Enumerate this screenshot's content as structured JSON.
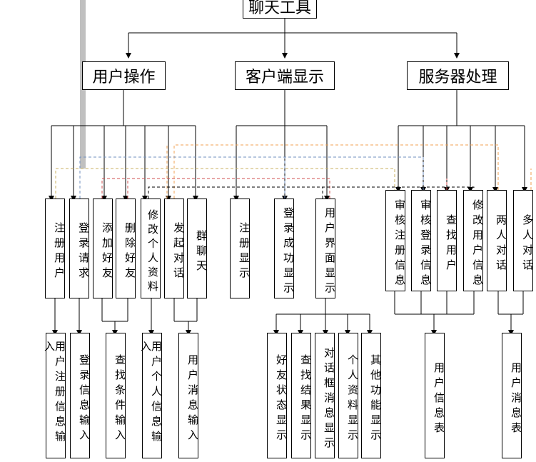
{
  "root": {
    "label": "聊天工具"
  },
  "level1": [
    {
      "id": "user_ops",
      "label": "用户操作"
    },
    {
      "id": "client_display",
      "label": "客户端显示"
    },
    {
      "id": "server",
      "label": "服务器处理"
    }
  ],
  "user_ops_children": [
    {
      "label": "注册用户"
    },
    {
      "label": "登录请求"
    },
    {
      "label": "添加好友"
    },
    {
      "label": "删除好友"
    },
    {
      "label": "修改个人资料"
    },
    {
      "label": "发起对话"
    },
    {
      "label": "群聊天"
    }
  ],
  "client_children": [
    {
      "label": "注册显示"
    },
    {
      "label": "登录成功显示"
    },
    {
      "label": "用户界面显示"
    }
  ],
  "server_children": [
    {
      "label": "审核注册信息"
    },
    {
      "label": "审核登录信息"
    },
    {
      "label": "查找用户"
    },
    {
      "label": "修改用户信息"
    },
    {
      "label": "两人对话"
    },
    {
      "label": "多人对话"
    }
  ],
  "bottom_user": [
    {
      "label": "用户注册信息输入"
    },
    {
      "label": "登录信息输入"
    },
    {
      "label": "查找条件输入"
    },
    {
      "label": "用户个人信息输入"
    },
    {
      "label": "用户消息输入"
    }
  ],
  "bottom_client": [
    {
      "label": "好友状态显示"
    },
    {
      "label": "查找结果显示"
    },
    {
      "label": "对话框消息显示"
    },
    {
      "label": "个人资料显示"
    },
    {
      "label": "其他功能显示"
    }
  ],
  "bottom_server": [
    {
      "label": "用户信息表"
    },
    {
      "label": "用户消息表"
    }
  ],
  "colors": {
    "line": "#000000",
    "dash_orange": "#f0a050",
    "dash_blue": "#6f8fbf",
    "dash_olive": "#c8b060",
    "dash_red": "#d05050",
    "dash_black": "#000000",
    "scrollbar": "#c0c0c0"
  }
}
